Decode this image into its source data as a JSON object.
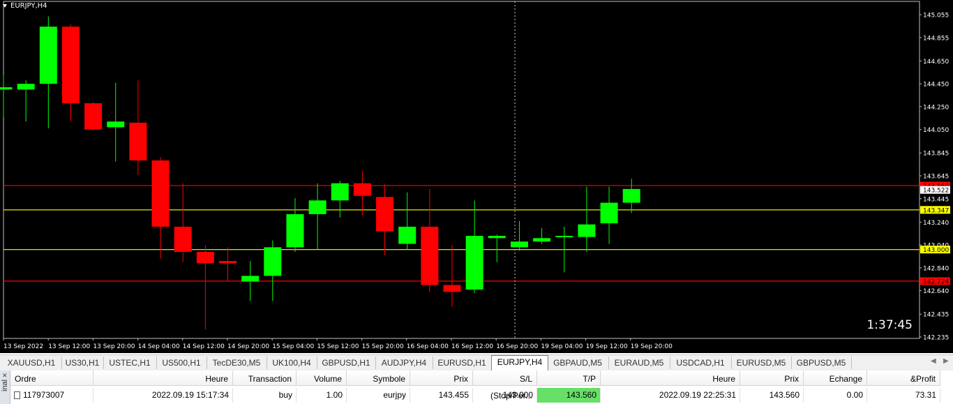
{
  "chart": {
    "symbol_label": "EURJPY,H4",
    "countdown": "1:37:45",
    "colors": {
      "background": "#000000",
      "bull": "#00ff00",
      "bear": "#ff0000",
      "axis_text": "#ffffff",
      "line_red": "#ff0000",
      "line_yellow": "#ffff00"
    }
  },
  "chart_data": {
    "type": "candlestick",
    "title": "EURJPY,H4",
    "ylim": [
      142.2,
      145.15
    ],
    "y_ticks": [
      "145.055",
      "144.855",
      "144.650",
      "144.450",
      "144.250",
      "144.050",
      "143.845",
      "143.645",
      "143.445",
      "143.240",
      "143.040",
      "142.840",
      "142.640",
      "142.435",
      "142.235"
    ],
    "x_tick_labels": [
      "13 Sep 2022",
      "13 Sep 12:00",
      "13 Sep 20:00",
      "14 Sep 04:00",
      "14 Sep 12:00",
      "14 Sep 20:00",
      "15 Sep 04:00",
      "15 Sep 12:00",
      "15 Sep 20:00",
      "16 Sep 04:00",
      "16 Sep 12:00",
      "16 Sep 20:00",
      "19 Sep 04:00",
      "19 Sep 12:00",
      "19 Sep 20:00"
    ],
    "candles": [
      {
        "o": 144.4,
        "h": 144.53,
        "l": 144.16,
        "c": 144.42
      },
      {
        "o": 144.4,
        "h": 144.48,
        "l": 144.12,
        "c": 144.45
      },
      {
        "o": 144.45,
        "h": 145.04,
        "l": 144.06,
        "c": 144.95
      },
      {
        "o": 144.95,
        "h": 144.97,
        "l": 144.12,
        "c": 144.28
      },
      {
        "o": 144.28,
        "h": 144.29,
        "l": 144.04,
        "c": 144.05
      },
      {
        "o": 144.07,
        "h": 144.46,
        "l": 143.77,
        "c": 144.12
      },
      {
        "o": 144.11,
        "h": 144.48,
        "l": 143.65,
        "c": 143.78
      },
      {
        "o": 143.78,
        "h": 143.81,
        "l": 142.92,
        "c": 143.2
      },
      {
        "o": 143.2,
        "h": 143.58,
        "l": 142.89,
        "c": 142.98
      },
      {
        "o": 142.98,
        "h": 143.04,
        "l": 142.3,
        "c": 142.88
      },
      {
        "o": 142.9,
        "h": 143.02,
        "l": 142.72,
        "c": 142.88
      },
      {
        "o": 142.72,
        "h": 142.9,
        "l": 142.55,
        "c": 142.77
      },
      {
        "o": 142.77,
        "h": 143.08,
        "l": 142.55,
        "c": 143.02
      },
      {
        "o": 143.02,
        "h": 143.45,
        "l": 142.98,
        "c": 143.31
      },
      {
        "o": 143.31,
        "h": 143.58,
        "l": 143.0,
        "c": 143.43
      },
      {
        "o": 143.43,
        "h": 143.6,
        "l": 143.28,
        "c": 143.58
      },
      {
        "o": 143.58,
        "h": 143.69,
        "l": 143.3,
        "c": 143.47
      },
      {
        "o": 143.46,
        "h": 143.57,
        "l": 142.95,
        "c": 143.16
      },
      {
        "o": 143.05,
        "h": 143.5,
        "l": 143.0,
        "c": 143.2
      },
      {
        "o": 143.2,
        "h": 143.53,
        "l": 142.63,
        "c": 142.69
      },
      {
        "o": 142.69,
        "h": 143.04,
        "l": 142.5,
        "c": 142.63
      },
      {
        "o": 142.65,
        "h": 143.43,
        "l": 142.62,
        "c": 143.12
      },
      {
        "o": 143.1,
        "h": 143.13,
        "l": 142.89,
        "c": 143.12
      },
      {
        "o": 143.02,
        "h": 143.25,
        "l": 142.99,
        "c": 143.07
      },
      {
        "o": 143.07,
        "h": 143.19,
        "l": 143.05,
        "c": 143.1
      },
      {
        "o": 143.11,
        "h": 143.2,
        "l": 142.8,
        "c": 143.12
      },
      {
        "o": 143.11,
        "h": 143.55,
        "l": 142.98,
        "c": 143.22
      },
      {
        "o": 143.23,
        "h": 143.55,
        "l": 143.05,
        "c": 143.41
      },
      {
        "o": 143.41,
        "h": 143.62,
        "l": 143.32,
        "c": 143.53
      }
    ],
    "price_lines": [
      {
        "price": 143.56,
        "label": "143.560",
        "kind": "tp",
        "color": "#ff0000"
      },
      {
        "price": 143.347,
        "label": "143.347",
        "kind": "entry",
        "color": "#ffff00"
      },
      {
        "price": 143.0,
        "label": "143.000",
        "kind": "sl",
        "color": "#ffff00"
      },
      {
        "price": 142.724,
        "label": "142.724",
        "kind": "level",
        "color": "#ff0000"
      }
    ],
    "current_price": {
      "price": 143.522,
      "label": "143.522"
    },
    "vertical_marker_candle_index": 22.8
  },
  "tabs": {
    "items": [
      "XAUUSD,H1",
      "US30,H1",
      "USTEC,H1",
      "US500,H1",
      "TecDE30,M5",
      "UK100,H4",
      "GBPUSD,H1",
      "AUDJPY,H4",
      "EURUSD,H1",
      "EURJPY,H4",
      "GBPAUD,M5",
      "EURAUD,M5",
      "USDCAD,H1",
      "EURUSD,M5",
      "GBPUSD,M5"
    ],
    "active_index": 9
  },
  "terminal": {
    "side_label": "inal",
    "headers": [
      "Ordre",
      "Heure",
      "Transaction",
      "Volume",
      "Symbole",
      "Prix",
      "S/L (Stop/Per...",
      "T/P (Prendre...",
      "Heure",
      "Prix",
      "Echange",
      "&Profit"
    ],
    "row": [
      "117973007",
      "2022.09.19 15:17:34",
      "buy",
      "1.00",
      "eurjpy",
      "143.455",
      "143.000",
      "143.560",
      "2022.09.19 22:25:31",
      "143.560",
      "0.00",
      "73.31"
    ]
  }
}
